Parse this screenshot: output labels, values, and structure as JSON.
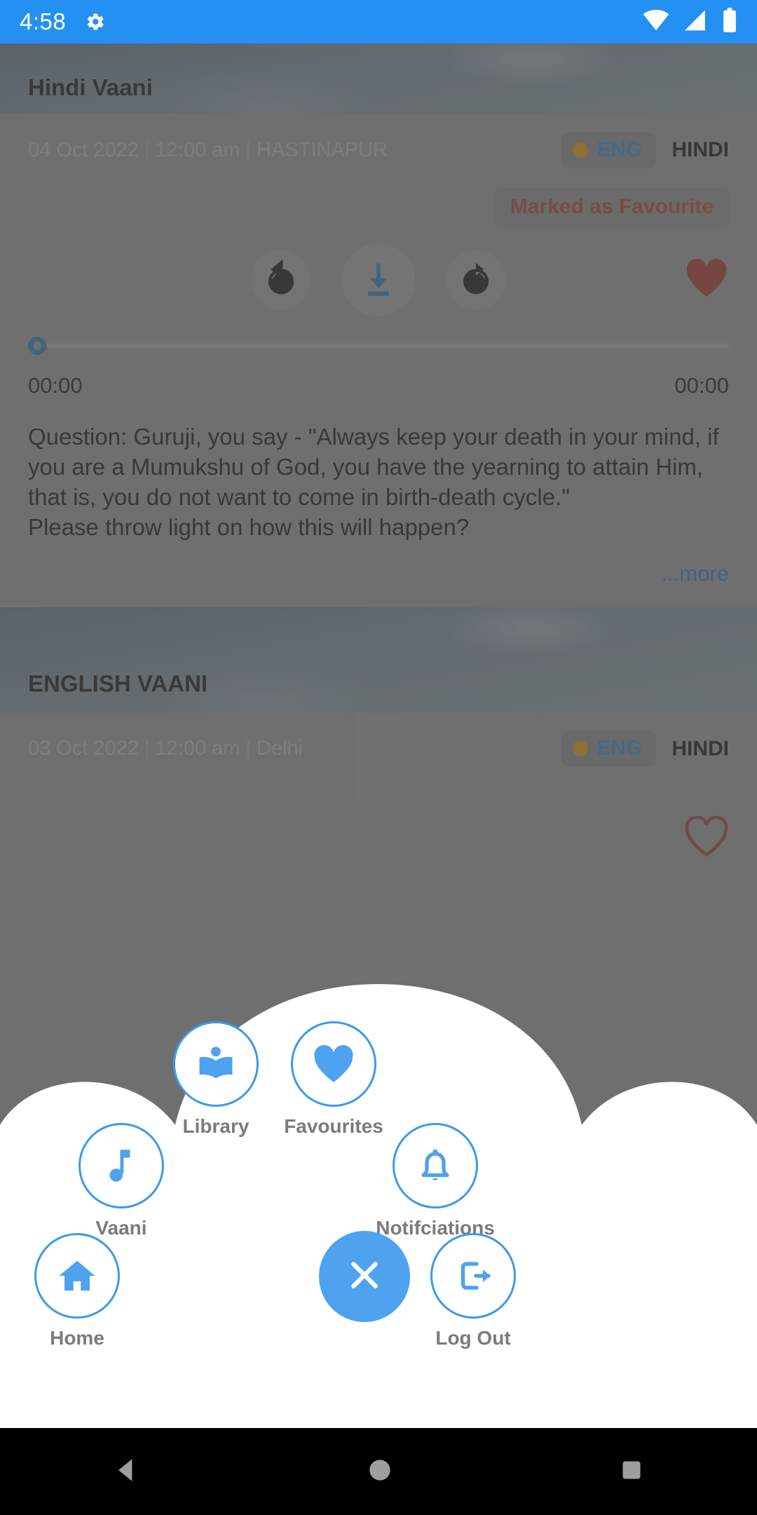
{
  "status_bar": {
    "time": "4:58",
    "icons": [
      "gear-icon",
      "wifi-icon",
      "signal-icon",
      "battery-icon"
    ]
  },
  "colors": {
    "status_bar_bg": "#2491f2",
    "accent_blue": "#4ea2ef",
    "icon_blue": "#3d9ae8",
    "favourite_red": "#a23b34",
    "link_blue": "#2b6cb8",
    "lang_dot_orange": "#d08b06",
    "label_gray": "#7b7b7b",
    "scrim": "rgba(90,90,90,0.55)"
  },
  "cards": [
    {
      "banner_title": "Hindi Vaani",
      "date": "04 Oct 2022",
      "time": "12:00 am",
      "location": "HASTINAPUR",
      "lang_selected": "ENG",
      "lang_other": "HINDI",
      "favourite_badge": "Marked as Favourite",
      "controls": {
        "rewind": "replay-10-icon",
        "download": "download-icon",
        "forward": "forward-10-icon",
        "favourite": "heart-filled-icon"
      },
      "seek": {
        "position": 0,
        "elapsed": "00:00",
        "duration": "00:00"
      },
      "description": "Question: Guruji, you say - \"Always keep your death in your mind, if you are a Mumukshu of God, you have the yearning to attain Him, that is, you do not want to come in birth-death cycle.\"\nPlease throw light on how this will happen?",
      "more_label": "...more"
    },
    {
      "banner_title": "ENGLISH VAANI",
      "date": "03 Oct 2022",
      "time": "12:00 am",
      "location": "Delhi",
      "lang_selected": "ENG",
      "lang_other": "HINDI"
    }
  ],
  "fab_menu": {
    "close_label": "close-icon",
    "items": [
      {
        "label": "Library",
        "icon": "library-icon"
      },
      {
        "label": "Favourites",
        "icon": "heart-icon"
      },
      {
        "label": "Vaani",
        "icon": "music-note-icon"
      },
      {
        "label": "Notifciations",
        "icon": "bell-icon"
      },
      {
        "label": "Home",
        "icon": "home-icon"
      },
      {
        "label": "Log Out",
        "icon": "logout-icon"
      }
    ]
  },
  "nav_bar": {
    "back": "back-triangle-icon",
    "home": "home-circle-icon",
    "recents": "recents-square-icon"
  }
}
